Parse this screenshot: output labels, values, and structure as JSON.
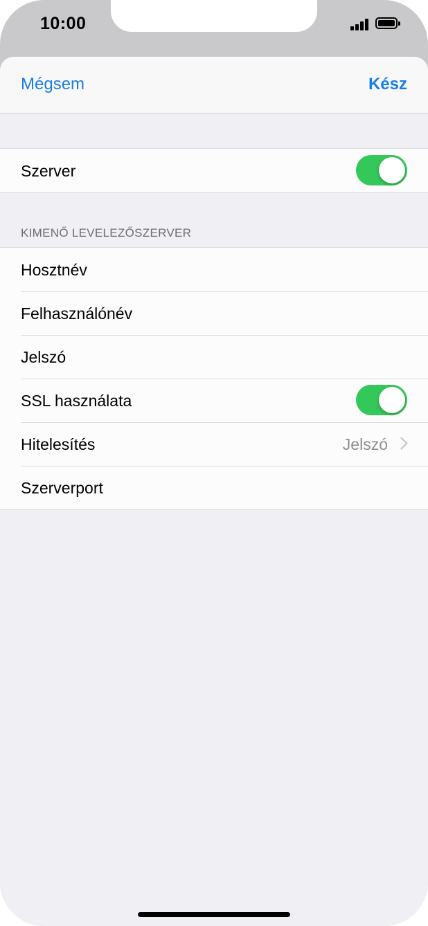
{
  "status_bar": {
    "time": "10:00",
    "icons": [
      "signal-icon",
      "battery-icon"
    ]
  },
  "navbar": {
    "cancel_label": "Mégsem",
    "done_label": "Kész",
    "accent_color": "#1a7ee8"
  },
  "server_group": {
    "label": "Szerver",
    "enabled": true
  },
  "outgoing_section": {
    "header": "KIMENŐ LEVELEZŐSZERVER",
    "rows": [
      {
        "label": "Hosztnév"
      },
      {
        "label": "Felhasználónév"
      },
      {
        "label": "Jelszó"
      },
      {
        "label": "SSL használata",
        "enabled": true
      },
      {
        "label": "Hitelesítés",
        "value": "Jelszó"
      },
      {
        "label": "Szerverport"
      }
    ]
  },
  "colors": {
    "toggle_on": "#34c759",
    "background": "#efeff4"
  }
}
